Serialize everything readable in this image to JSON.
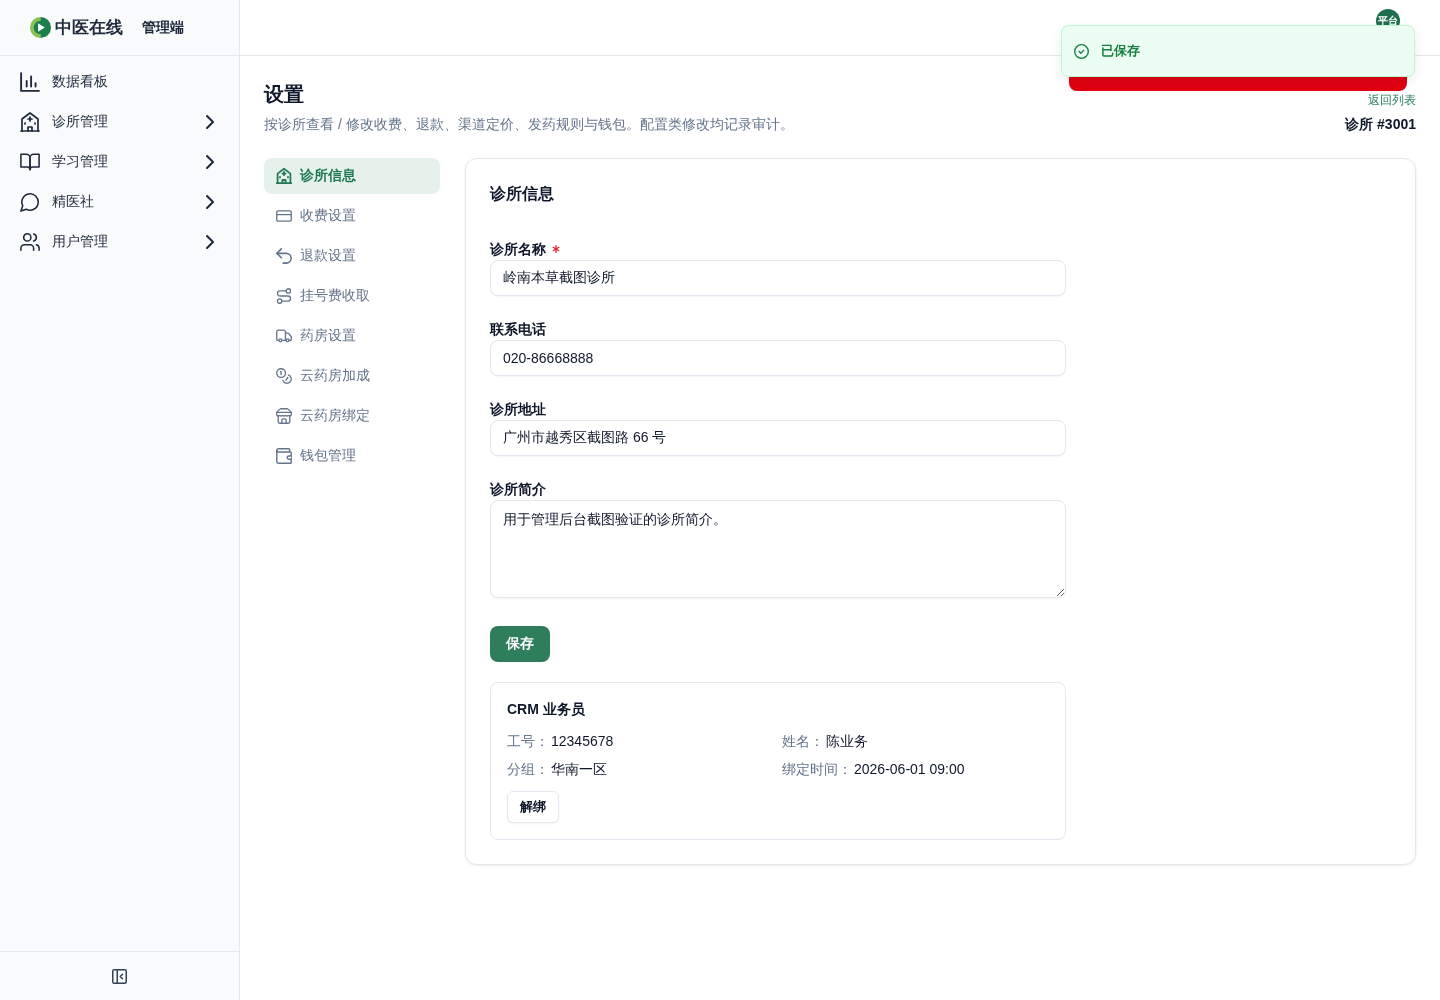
{
  "sidebar": {
    "brand": "中医在线",
    "subtitle": "管理端",
    "items": [
      {
        "label": "数据看板",
        "has_submenu": false
      },
      {
        "label": "诊所管理",
        "has_submenu": true
      },
      {
        "label": "学习管理",
        "has_submenu": true
      },
      {
        "label": "精医社",
        "has_submenu": true
      },
      {
        "label": "用户管理",
        "has_submenu": true
      }
    ]
  },
  "header": {
    "avatar": "平台"
  },
  "toasts": [
    {
      "kind": "success",
      "message": "已保存"
    },
    {
      "kind": "error"
    }
  ],
  "page": {
    "title": "设置",
    "description": "按诊所查看 / 修改收费、退款、渠道定价、发药规则与钱包。配置类修改均记录审计。",
    "back_link": "返回列表",
    "clinic_label": "诊所 #3001"
  },
  "settings_nav": [
    {
      "label": "诊所信息",
      "selected": true
    },
    {
      "label": "收费设置",
      "selected": false
    },
    {
      "label": "退款设置",
      "selected": false
    },
    {
      "label": "挂号费收取",
      "selected": false
    },
    {
      "label": "药房设置",
      "selected": false
    },
    {
      "label": "云药房加成",
      "selected": false
    },
    {
      "label": "云药房绑定",
      "selected": false
    },
    {
      "label": "钱包管理",
      "selected": false
    }
  ],
  "card": {
    "title": "诊所信息",
    "fields": [
      {
        "kind": "input",
        "label": "诊所名称",
        "required": true,
        "value": "岭南本草截图诊所"
      },
      {
        "kind": "input",
        "label": "联系电话",
        "required": false,
        "value": "020-86668888"
      },
      {
        "kind": "input",
        "label": "诊所地址",
        "required": false,
        "value": "广州市越秀区截图路 66 号"
      },
      {
        "kind": "textarea",
        "label": "诊所简介",
        "required": false,
        "value": "用于管理后台截图验证的诊所简介。"
      }
    ],
    "save_button": "保存",
    "crm": {
      "title": "CRM 业务员",
      "fields": [
        {
          "label": "工号：",
          "value": "12345678"
        },
        {
          "label": "姓名：",
          "value": "陈业务"
        },
        {
          "label": "分组：",
          "value": "华南一区"
        },
        {
          "label": "绑定时间：",
          "value": "2026-06-01 09:00"
        }
      ],
      "unbind_button": "解绑"
    }
  }
}
